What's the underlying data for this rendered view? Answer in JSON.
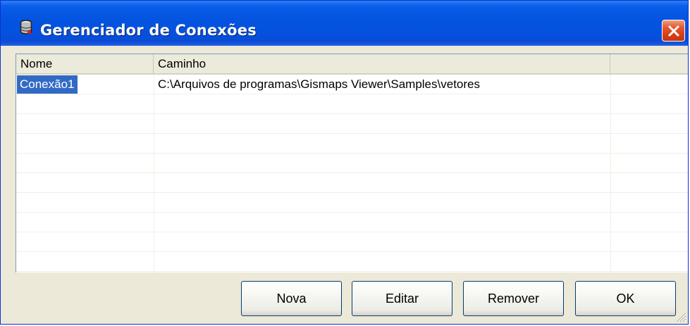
{
  "window": {
    "title": "Gerenciador de Conexões"
  },
  "grid": {
    "columns": [
      "Nome",
      "Caminho",
      ""
    ],
    "rows": [
      {
        "nome": "Conexão1",
        "caminho": "C:\\Arquivos de programas\\Gismaps Viewer\\Samples\\vetores",
        "selected": true
      }
    ]
  },
  "buttons": {
    "nova": "Nova",
    "editar": "Editar",
    "remover": "Remover",
    "ok": "OK"
  },
  "colors": {
    "titlebar": "#0454e0",
    "selection": "#316ac5",
    "close": "#d63c13"
  },
  "icons": {
    "app": "database-cylinder-icon",
    "close": "close-icon",
    "grip": "resize-grip-icon"
  }
}
